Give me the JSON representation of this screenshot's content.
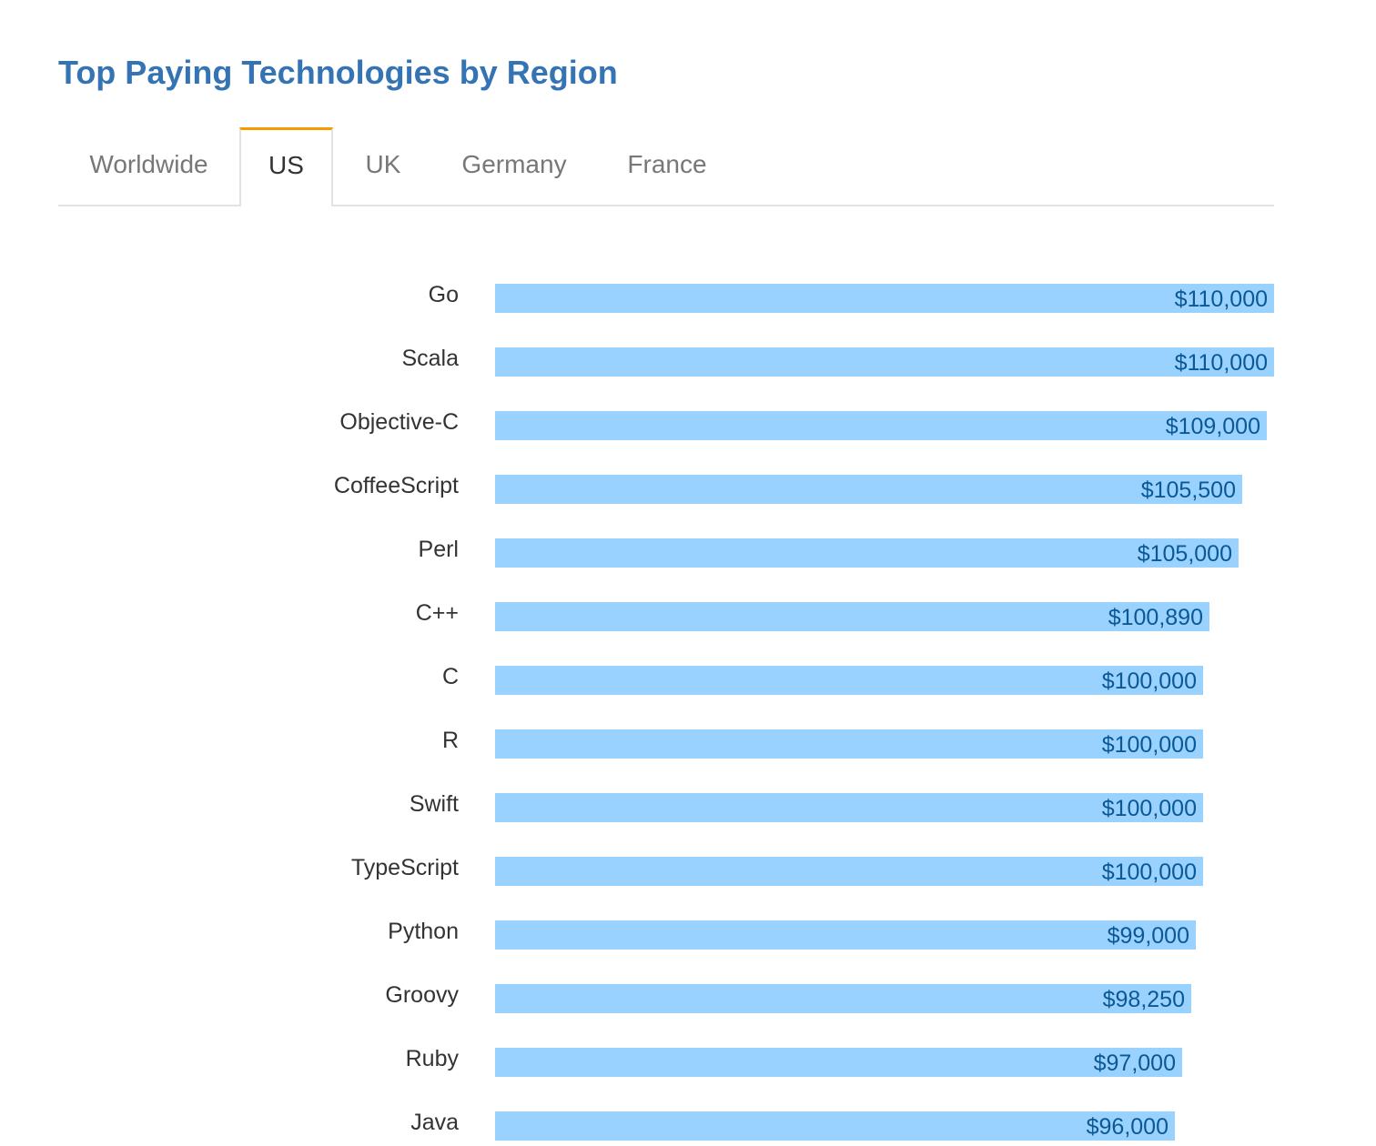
{
  "page": {
    "title": "Top Paying Technologies by Region"
  },
  "tabs": [
    {
      "label": "Worldwide",
      "active": false
    },
    {
      "label": "US",
      "active": true
    },
    {
      "label": "UK",
      "active": false
    },
    {
      "label": "Germany",
      "active": false
    },
    {
      "label": "France",
      "active": false
    }
  ],
  "colors": {
    "title": "#3474b4",
    "active_tab_accent": "#f59b00",
    "bar": "#99d2ff",
    "value_label": "#0b5894"
  },
  "chart_data": {
    "type": "bar",
    "orientation": "horizontal",
    "categories": [
      "Go",
      "Scala",
      "Objective-C",
      "CoffeeScript",
      "Perl",
      "C++",
      "C",
      "R",
      "Swift",
      "TypeScript",
      "Python",
      "Groovy",
      "Ruby",
      "Java"
    ],
    "values": [
      110000,
      110000,
      109000,
      105500,
      105000,
      100890,
      100000,
      100000,
      100000,
      100000,
      99000,
      98250,
      97000,
      96000
    ],
    "value_labels": [
      "$110,000",
      "$110,000",
      "$109,000",
      "$105,500",
      "$105,000",
      "$100,890",
      "$100,000",
      "$100,000",
      "$100,000",
      "$100,000",
      "$99,000",
      "$98,250",
      "$97,000",
      "$96,000"
    ],
    "xlim": [
      0,
      110000
    ],
    "grid": false,
    "legend": "none"
  }
}
